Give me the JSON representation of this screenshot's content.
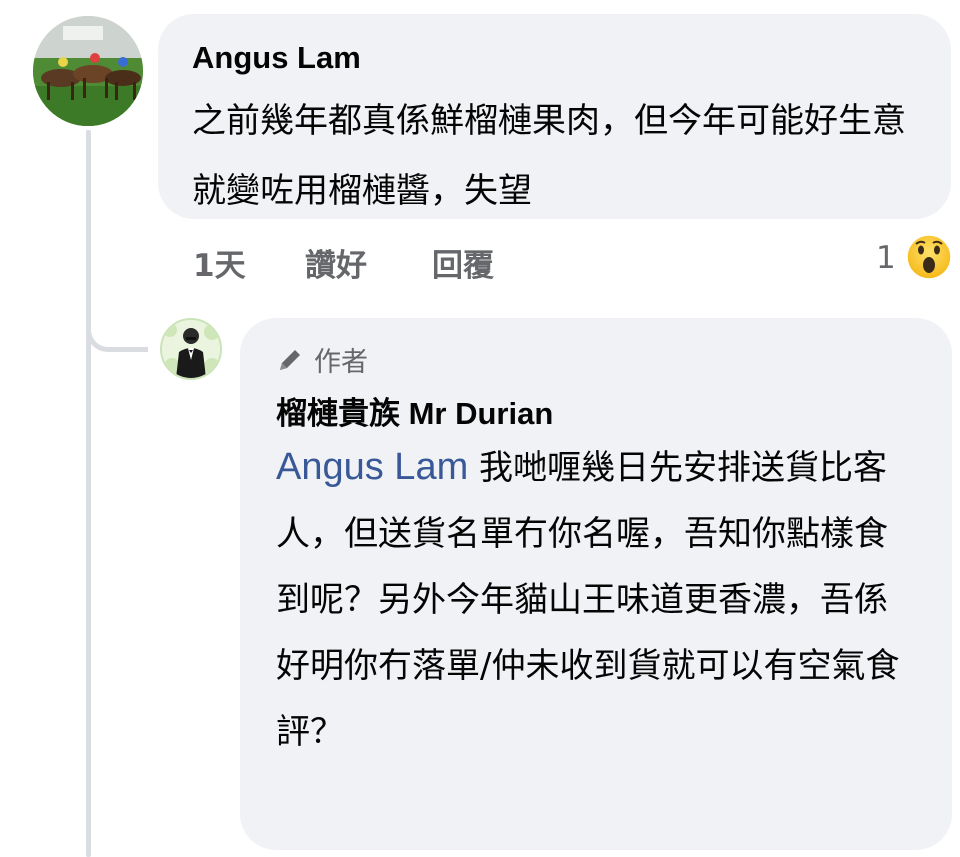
{
  "comment": {
    "author": "Angus Lam",
    "text": "之前幾年都真係鮮榴槤果肉，但今年可能好生意就變咗用榴槤醬，失望",
    "time": "1天",
    "like_label": "讚好",
    "reply_label": "回覆",
    "reaction_count": "1",
    "reaction_icon": "wow-emoji-icon",
    "avatar_icon": "horse-racing-photo"
  },
  "reply": {
    "badge_label": "作者",
    "badge_icon": "pencil-icon",
    "author": "榴槤貴族 Mr Durian",
    "mention": "Angus Lam",
    "text": " 我哋喱幾日先安排送貨比客人，但送貨名單冇你名喔，吾知你點樣食到呢？另外今年貓山王味道更香濃，吾係好明你冇落單/仲未收到貨就可以有空氣食評？",
    "avatar_icon": "man-in-suit-avatar"
  },
  "colors": {
    "bubble": "#f0f2f5",
    "mention": "#385898",
    "meta": "#65676b",
    "thread_line": "#d9dce0"
  }
}
